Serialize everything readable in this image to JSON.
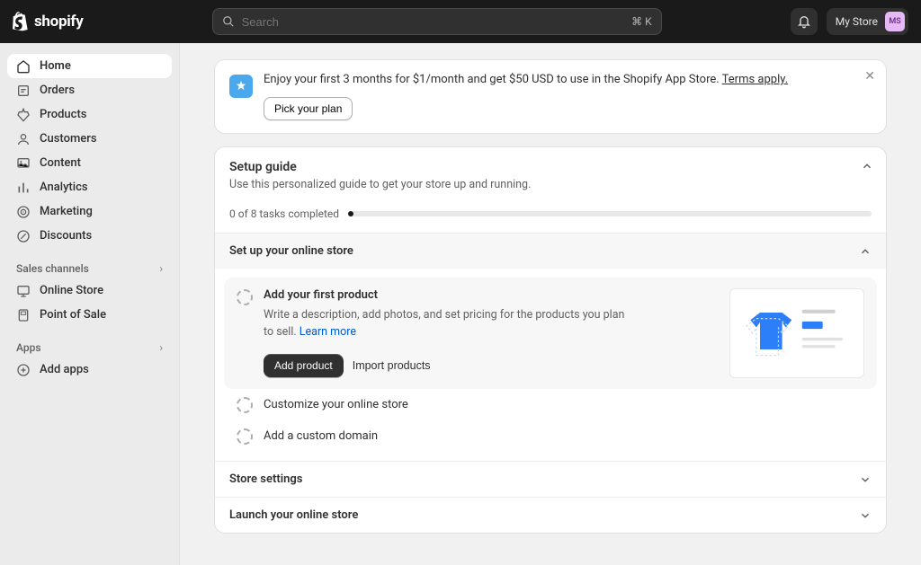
{
  "brand": "shopify",
  "search": {
    "placeholder": "Search",
    "shortcut": "⌘ K"
  },
  "store": {
    "name": "My Store",
    "initials": "MS"
  },
  "nav": {
    "items": [
      {
        "label": "Home"
      },
      {
        "label": "Orders"
      },
      {
        "label": "Products"
      },
      {
        "label": "Customers"
      },
      {
        "label": "Content"
      },
      {
        "label": "Analytics"
      },
      {
        "label": "Marketing"
      },
      {
        "label": "Discounts"
      }
    ],
    "sales_channels": {
      "title": "Sales channels",
      "items": [
        {
          "label": "Online Store"
        },
        {
          "label": "Point of Sale"
        }
      ]
    },
    "apps": {
      "title": "Apps",
      "items": [
        {
          "label": "Add apps"
        }
      ]
    }
  },
  "banner": {
    "text_prefix": "Enjoy your first 3 months for $1/month and get $50 USD to use in the Shopify App Store. ",
    "terms_link": "Terms apply.",
    "button": "Pick your plan"
  },
  "guide": {
    "title": "Setup guide",
    "subtitle": "Use this personalized guide to get your store up and running.",
    "progress_text": "0 of 8 tasks completed",
    "sections": {
      "setup": {
        "title": "Set up your online store",
        "tasks": [
          {
            "title": "Add your first product",
            "description": "Write a description, add photos, and set pricing for the products you plan to sell. ",
            "learn_more": "Learn more",
            "primary_action": "Add product",
            "secondary_action": "Import products"
          },
          {
            "title": "Customize your online store"
          },
          {
            "title": "Add a custom domain"
          }
        ]
      },
      "store_settings": {
        "title": "Store settings"
      },
      "launch": {
        "title": "Launch your online store"
      }
    }
  }
}
